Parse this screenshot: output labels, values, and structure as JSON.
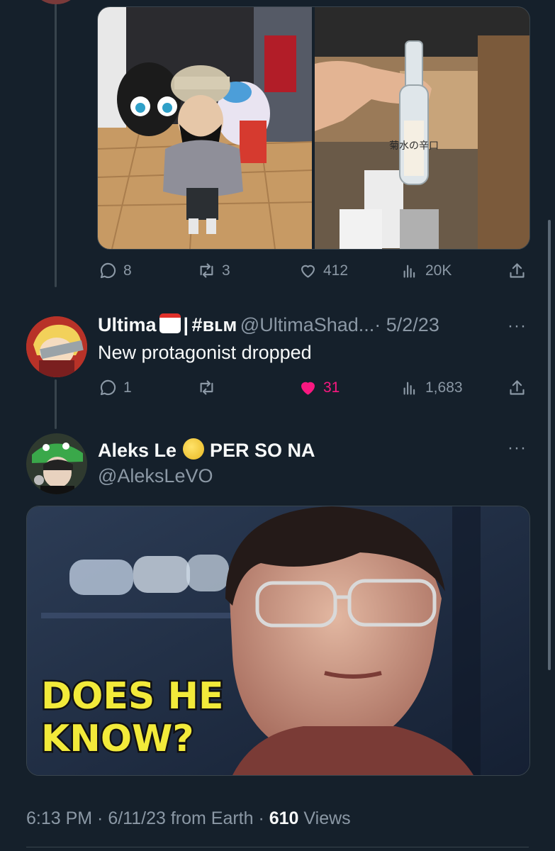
{
  "tweet1": {
    "stats": {
      "replies": "8",
      "retweets": "3",
      "likes": "412",
      "views": "20K"
    },
    "photo2_label": "菊水の辛口"
  },
  "tweet2": {
    "name": "Ultima",
    "badge_sep": "|",
    "hashtag": "#ʙʟᴍ",
    "handle": "@UltimaShad...",
    "date": "· 5/2/23",
    "more": "···",
    "text": "New protagonist dropped",
    "stats": {
      "replies": "1",
      "retweets": "",
      "likes": "31",
      "views": "1,683"
    }
  },
  "tweet3": {
    "name_prefix": "Aleks Le",
    "name_suffix": "PER SO NA",
    "handle": "@AleksLeVO",
    "more": "···",
    "image_caption_line1": "DOES HE",
    "image_caption_line2": "KNOW?",
    "meta_time": "6:13 PM · 6/11/23 from Earth ·",
    "meta_views_count": "610",
    "meta_views_label": "Views"
  },
  "colors": {
    "background": "#15202b",
    "muted": "#8b98a5",
    "like": "#f91880",
    "accent": "#1d9bf0"
  }
}
